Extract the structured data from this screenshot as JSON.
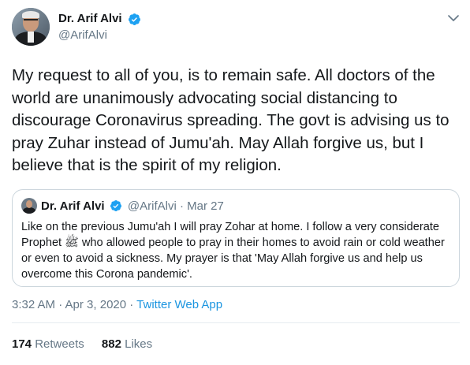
{
  "author": {
    "display_name": "Dr. Arif Alvi",
    "handle": "@ArifAlvi",
    "verified": true
  },
  "tweet": {
    "text": "My request to all of you, is to remain safe. All doctors of the world are unanimously advocating social distancing to discourage Coronavirus spreading. The govt is advising us to pray Zuhar instead of Jumu'ah. May Allah forgive us, but I believe that is the spirit of my religion.",
    "timestamp": "3:32 AM · Apr 3, 2020",
    "separator": " · ",
    "source": "Twitter Web App"
  },
  "quoted_tweet": {
    "display_name": "Dr. Arif Alvi",
    "handle": "@ArifAlvi",
    "dot": "·",
    "date": "Mar 27",
    "text": "Like on the previous Jumu'ah I will pray Zohar at home. I follow a very considerate Prophet ﷺ who allowed people to pray in their homes to avoid rain or cold weather or even to avoid a sickness. My prayer is that 'May Allah forgive us and help us overcome this Corona pandemic'."
  },
  "stats": {
    "retweets_count": "174",
    "retweets_label": "Retweets",
    "likes_count": "882",
    "likes_label": "Likes"
  },
  "colors": {
    "verified_blue": "#1da1f2",
    "link_blue": "#1b95e0",
    "secondary_text": "#657786",
    "border": "#ccd6dd"
  },
  "icons": {
    "verified": "verified-badge-icon",
    "menu": "chevron-down-icon"
  }
}
